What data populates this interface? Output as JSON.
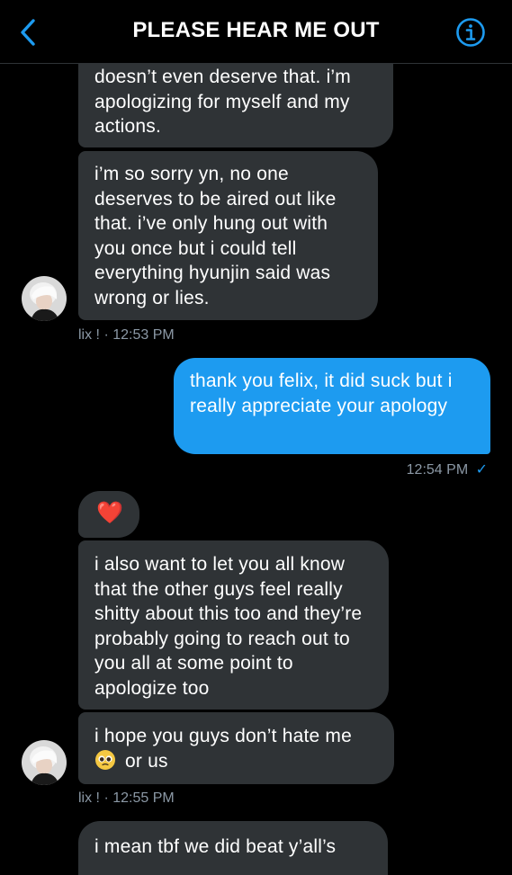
{
  "header": {
    "title": "PLEASE HEAR ME OUT"
  },
  "colors": {
    "accent": "#1d9bf0",
    "incoming_bubble": "#2f3336",
    "meta_text": "#8b98a5",
    "background": "#000000"
  },
  "messages": [
    {
      "text": "doesn’t even deserve that. i’m apologizing for myself and my actions."
    },
    {
      "text": "i’m so sorry yn, no one deserves to be aired out like that. i’ve only hung out with you once but i could tell everything hyunjin said was wrong or lies."
    },
    {
      "meta": "lix ! · 12:53 PM"
    },
    {
      "text": "thank you felix, it did suck but i really appreciate your apology"
    },
    {
      "meta": "12:54 PM",
      "check": "✓"
    },
    {
      "text": "❤️"
    },
    {
      "text": "i also want to let you all know that the other guys feel really shitty about this too and they’re probably going to reach out to you all at some point to apologize too"
    },
    {
      "text_before": "i hope you guys don’t hate me",
      "text_after": "or us"
    },
    {
      "meta": "lix ! · 12:55 PM"
    },
    {
      "text": "i mean tbf we did beat y’all’s"
    }
  ]
}
